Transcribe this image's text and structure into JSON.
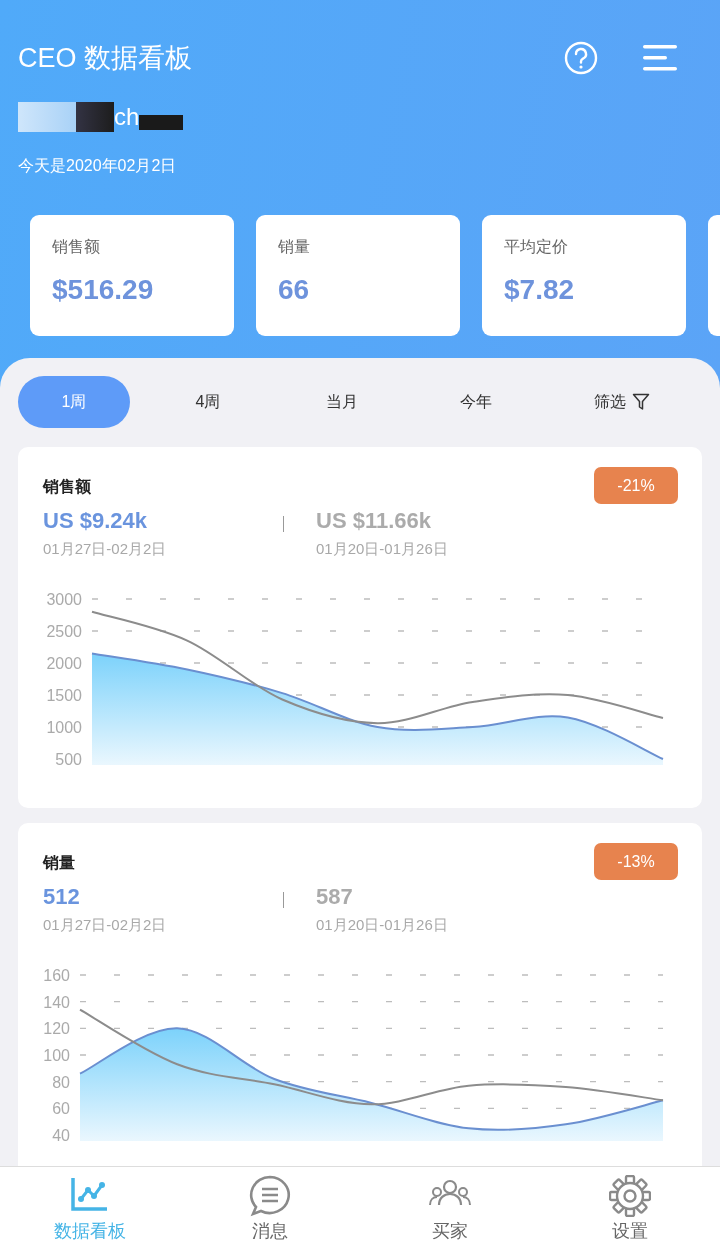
{
  "header": {
    "title": "CEO 数据看板",
    "user_name": "ch",
    "date": "今天是2020年02月2日"
  },
  "stats": [
    {
      "label": "销售额",
      "value": "$516.29"
    },
    {
      "label": "销量",
      "value": "66"
    },
    {
      "label": "平均定价",
      "value": "$7.82"
    }
  ],
  "period_tabs": [
    {
      "label": "1周",
      "selected": true
    },
    {
      "label": "4周",
      "selected": false
    },
    {
      "label": "当月",
      "selected": false
    },
    {
      "label": "今年",
      "selected": false
    }
  ],
  "filter": {
    "label": "筛选"
  },
  "metric_cards": [
    {
      "title": "销售额",
      "current_value": "US $9.24k",
      "current_range": "01月27日-02月2日",
      "previous_value": "US $11.66k",
      "previous_range": "01月20日-01月26日",
      "change": "-21%",
      "chart_data": {
        "type": "area",
        "grid": true,
        "ylim": [
          500,
          3000
        ],
        "yticks": [
          500,
          1000,
          1500,
          2000,
          2500,
          3000
        ],
        "series": [
          {
            "type": "area",
            "color": "#6a8fd0",
            "values": [
              2150,
              1900,
              1530,
              1000,
              1000,
              1150,
              500
            ]
          },
          {
            "type": "line",
            "color": "#8c8c8c",
            "values": [
              2800,
              2350,
              1430,
              1060,
              1390,
              1500,
              1140
            ]
          }
        ]
      }
    },
    {
      "title": "销量",
      "current_value": "512",
      "current_range": "01月27日-02月2日",
      "previous_value": "587",
      "previous_range": "01月20日-01月26日",
      "change": "-13%",
      "chart_data": {
        "type": "area",
        "grid": true,
        "ylim": [
          40,
          160
        ],
        "yticks": [
          40,
          60,
          80,
          100,
          120,
          140,
          160
        ],
        "series": [
          {
            "type": "area",
            "color": "#6a8fd0",
            "values": [
              86,
              120,
              82,
              64,
              45,
              48,
              66
            ]
          },
          {
            "type": "line",
            "color": "#8c8c8c",
            "values": [
              134,
              93,
              78,
              63,
              77,
              76,
              66
            ]
          }
        ]
      }
    }
  ],
  "nav": [
    {
      "label": "数据看板",
      "kind": "chart",
      "selected": true
    },
    {
      "label": "消息",
      "kind": "chat",
      "selected": false
    },
    {
      "label": "买家",
      "kind": "people",
      "selected": false
    },
    {
      "label": "设置",
      "kind": "gear",
      "selected": false
    }
  ]
}
